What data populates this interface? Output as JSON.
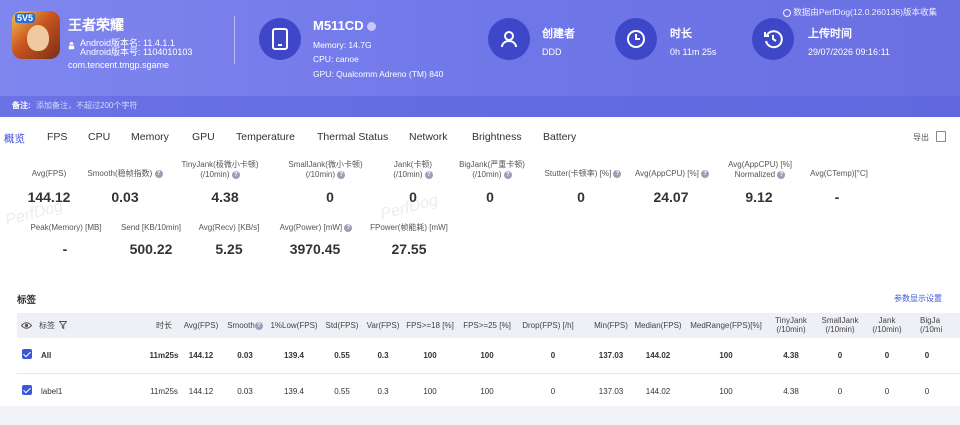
{
  "app": {
    "name": "王者荣耀",
    "icon_badge": "5V5",
    "android_version": "Android版本名: 11.4.1.1",
    "android_code": "Android版本号: 1104010103",
    "package": "com.tencent.tmgp.sgame"
  },
  "device": {
    "title": "M511CD",
    "memory": "Memory: 14.7G",
    "cpu": "CPU: canoe",
    "gpu": "GPU: Qualcomm Adreno (TM) 840"
  },
  "creator": {
    "label": "创建者",
    "value": "DDD"
  },
  "duration": {
    "label": "时长",
    "value": "0h 11m 25s"
  },
  "upload": {
    "label": "上传时间",
    "value": "29/07/2026 09:16:11"
  },
  "version_note": "数据由PerfDog(12.0.260136)版本收集",
  "notes": {
    "label": "备注:",
    "placeholder": "添加备注，不超过200个字符"
  },
  "tabs": [
    "概览",
    "FPS",
    "CPU",
    "Memory",
    "GPU",
    "Temperature",
    "Thermal Status",
    "Network",
    "Brightness",
    "Battery"
  ],
  "export_label": "导出",
  "stats_row1": [
    {
      "label": "Avg(FPS)",
      "value": "144.12"
    },
    {
      "label": "Smooth(稳帧指数)",
      "value": "0.03"
    },
    {
      "label": "TinyJank(极微小卡顿)\n(/10min)",
      "value": "4.38"
    },
    {
      "label": "SmallJank(微小卡顿)\n(/10min)",
      "value": "0"
    },
    {
      "label": "Jank(卡顿)\n(/10min)",
      "value": "0"
    },
    {
      "label": "BigJank(严重卡顿)\n(/10min)",
      "value": "0"
    },
    {
      "label": "Stutter(卡顿率) [%]",
      "value": "0"
    },
    {
      "label": "Avg(AppCPU) [%]",
      "value": "24.07"
    },
    {
      "label": "Avg(AppCPU) [%]\nNormalized",
      "value": "9.12"
    },
    {
      "label": "Avg(CTemp)[°C]",
      "value": "-"
    }
  ],
  "stats_row2": [
    {
      "label": "Peak(Memory) [MB]",
      "value": "-"
    },
    {
      "label": "Send [KB/10min]",
      "value": "500.22"
    },
    {
      "label": "Avg(Recv) [KB/s]",
      "value": "5.25"
    },
    {
      "label": "Avg(Power) [mW]",
      "value": "3970.45"
    },
    {
      "label": "FPower(帧能耗) [mW]",
      "value": "27.55"
    }
  ],
  "watermarks": [
    "PerfDog",
    "PerfDog"
  ],
  "tags": {
    "title": "标签",
    "param_link": "参数显示设置",
    "columns": [
      "标签",
      "时长",
      "Avg(FPS)",
      "Smooth",
      "1%Low(FPS)",
      "Std(FPS)",
      "Var(FPS)",
      "FPS>=18 [%]",
      "FPS>=25 [%]",
      "Drop(FPS) [/h]",
      "Min(FPS)",
      "Median(FPS)",
      "MedRange(FPS)[%]",
      "TinyJank\n(/10min)",
      "SmallJank\n(/10min)",
      "Jank\n(/10min)",
      "BigJa\n(/10mi"
    ],
    "rows": [
      {
        "name": "All",
        "cells": [
          "11m25s",
          "144.12",
          "0.03",
          "139.4",
          "0.55",
          "0.3",
          "100",
          "100",
          "0",
          "137.03",
          "144.02",
          "100",
          "4.38",
          "0",
          "0",
          "0"
        ]
      },
      {
        "name": "label1",
        "cells": [
          "11m25s",
          "144.12",
          "0.03",
          "139.4",
          "0.55",
          "0.3",
          "100",
          "100",
          "0",
          "137.03",
          "144.02",
          "100",
          "4.38",
          "0",
          "0",
          "0"
        ]
      }
    ]
  },
  "colors": {
    "accent": "#3c48d8",
    "header": "#767ceb",
    "icon_circle": "#3d47c8"
  }
}
